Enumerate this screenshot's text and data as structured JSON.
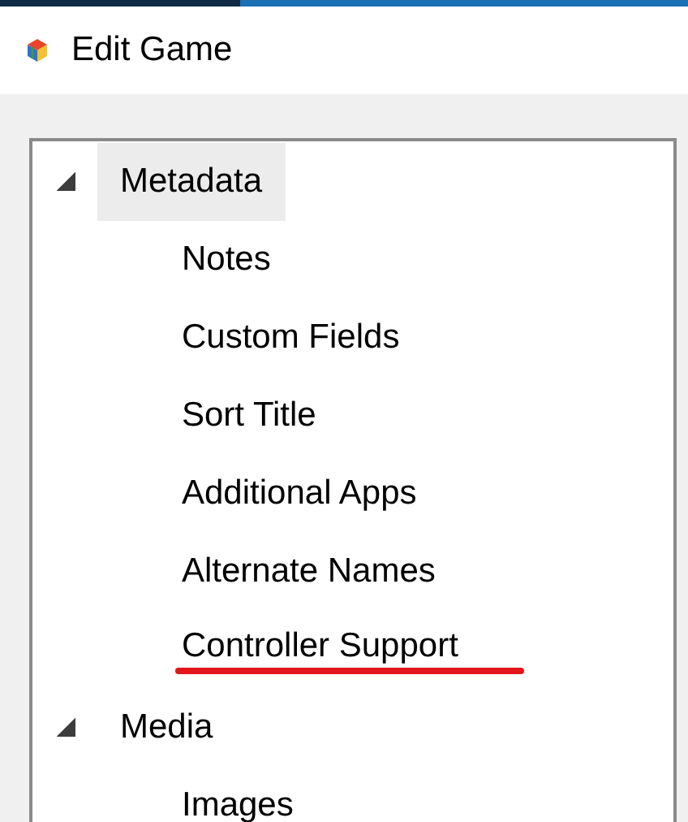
{
  "window": {
    "title": "Edit Game"
  },
  "tree": [
    {
      "label": "Metadata",
      "expanded": true,
      "selected": true,
      "children": [
        {
          "label": "Notes",
          "underlined": false
        },
        {
          "label": "Custom Fields",
          "underlined": false
        },
        {
          "label": "Sort Title",
          "underlined": false
        },
        {
          "label": "Additional Apps",
          "underlined": false
        },
        {
          "label": "Alternate Names",
          "underlined": false
        },
        {
          "label": "Controller Support",
          "underlined": true
        }
      ]
    },
    {
      "label": "Media",
      "expanded": true,
      "selected": false,
      "children": [
        {
          "label": "Images",
          "underlined": false
        }
      ]
    }
  ]
}
